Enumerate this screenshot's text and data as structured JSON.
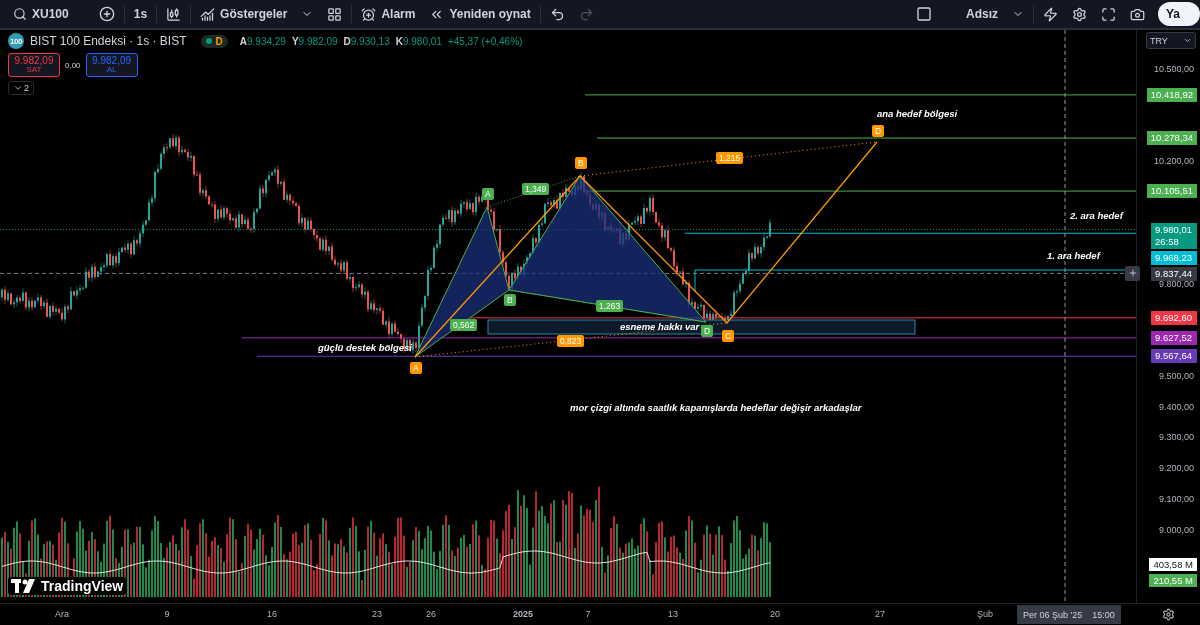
{
  "toolbar": {
    "symbol": "XU100",
    "interval": "1s",
    "indicators": "Göstergeler",
    "alarm": "Alarm",
    "replay": "Yeniden oynat",
    "redo_disabled": true,
    "layout_name": "Adsız",
    "publish": "Ya"
  },
  "legend": {
    "logo_text": "100",
    "title": "BIST 100 Endeksi · 1s · BIST",
    "badge": "D",
    "ohlc": [
      {
        "label": "A",
        "value": "9.934,29"
      },
      {
        "label": "Y",
        "value": "9.982,09"
      },
      {
        "label": "D",
        "value": "9.930,13"
      },
      {
        "label": "K",
        "value": "9.980,01"
      }
    ],
    "change": "+45,37 (+0,46%)"
  },
  "trade": {
    "sell": {
      "price": "9.982,09",
      "label": "SAT"
    },
    "spread": "0,00",
    "buy": {
      "price": "9.982,09",
      "label": "AL"
    },
    "collapse": "2"
  },
  "currency": "TRY",
  "price_ticks": [
    "10.500,00",
    "10.200,00",
    "9.800,00",
    "9.500,00",
    "9.400,00",
    "9.300,00",
    "9.200,00",
    "9.100,00",
    "9.000,00"
  ],
  "price_tags": [
    {
      "value": "10.418,92",
      "color": "#4caf50"
    },
    {
      "value": "10.278,34",
      "color": "#4caf50"
    },
    {
      "value": "10.105,51",
      "color": "#4caf50"
    },
    {
      "value": "9.980,01",
      "sub": "26:58",
      "color": "#089981"
    },
    {
      "value": "9.968,23",
      "color": "#00bcd4"
    },
    {
      "value": "9.837,44",
      "color": "#363a45",
      "add_button": true
    },
    {
      "value": "9.692,60",
      "color": "#f23645"
    },
    {
      "value": "9.627,52",
      "color": "#9c27b0"
    },
    {
      "value": "9.567,64",
      "color": "#673ab7"
    }
  ],
  "volume_tags": [
    {
      "value": "403,58 M",
      "color": "#ffffff"
    },
    {
      "value": "210,55 M",
      "color": "#4caf50"
    }
  ],
  "annotations": [
    "ana hedef bölgesi",
    "2. ara hedef",
    "1. ara hedef",
    "esneme hakkı var",
    "güçlü  destek bölgesi",
    "mor çizgi altında saatlık kapanışlarda hedeflar değişir arkadaşlar"
  ],
  "pattern_points": [
    {
      "label": "A",
      "color": "#4caf50"
    },
    {
      "label": "B",
      "color": "#4caf50"
    },
    {
      "label": "D",
      "color": "#4caf50"
    },
    {
      "label": "A",
      "color": "#ff9800"
    },
    {
      "label": "B",
      "color": "#ff9800"
    },
    {
      "label": "C",
      "color": "#ff9800"
    },
    {
      "label": "D",
      "color": "#ff9800"
    }
  ],
  "ratios": [
    {
      "text": "1,349",
      "color": "#4caf50"
    },
    {
      "text": "1,263",
      "color": "#4caf50"
    },
    {
      "text": "0,562",
      "color": "#4caf50"
    },
    {
      "text": "0,823",
      "color": "#ff9800"
    },
    {
      "text": "1,215",
      "color": "#ff9800"
    }
  ],
  "watermark_logo": "TradingView",
  "time_labels": [
    "Ara",
    "9",
    "16",
    "23",
    "26",
    "2025",
    "7",
    "13",
    "20",
    "27",
    "Şub"
  ],
  "crosshair_time": {
    "date": "Per 06 Şub '25",
    "time": "15:00"
  }
}
